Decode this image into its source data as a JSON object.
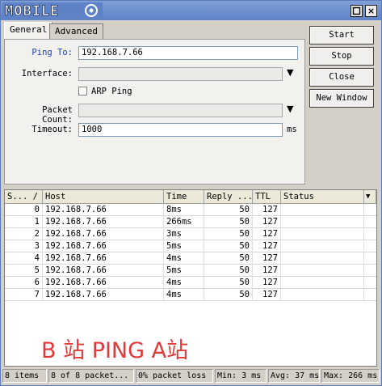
{
  "window": {
    "title": "MOBILE",
    "close_glyph": "×"
  },
  "tabs": [
    {
      "label": "General"
    },
    {
      "label": "Advanced"
    }
  ],
  "form": {
    "ping_to_label": "Ping To:",
    "ping_to_value": "192.168.7.66",
    "interface_label": "Interface:",
    "interface_value": "",
    "arp_ping_label": "ARP Ping",
    "arp_ping_checked": false,
    "packet_count_label": "Packet Count:",
    "packet_count_value": "",
    "timeout_label": "Timeout:",
    "timeout_value": "1000",
    "timeout_unit": "ms"
  },
  "buttons": {
    "start": "Start",
    "stop": "Stop",
    "close": "Close",
    "new_window": "New Window"
  },
  "table": {
    "headers": [
      "S... /",
      "Host",
      "Time",
      "Reply ...",
      "TTL",
      "Status"
    ],
    "rows": [
      {
        "seq": "0",
        "host": "192.168.7.66",
        "time": "8ms",
        "reply": "50",
        "ttl": "127",
        "status": ""
      },
      {
        "seq": "1",
        "host": "192.168.7.66",
        "time": "266ms",
        "reply": "50",
        "ttl": "127",
        "status": ""
      },
      {
        "seq": "2",
        "host": "192.168.7.66",
        "time": "3ms",
        "reply": "50",
        "ttl": "127",
        "status": ""
      },
      {
        "seq": "3",
        "host": "192.168.7.66",
        "time": "5ms",
        "reply": "50",
        "ttl": "127",
        "status": ""
      },
      {
        "seq": "4",
        "host": "192.168.7.66",
        "time": "4ms",
        "reply": "50",
        "ttl": "127",
        "status": ""
      },
      {
        "seq": "5",
        "host": "192.168.7.66",
        "time": "5ms",
        "reply": "50",
        "ttl": "127",
        "status": ""
      },
      {
        "seq": "6",
        "host": "192.168.7.66",
        "time": "4ms",
        "reply": "50",
        "ttl": "127",
        "status": ""
      },
      {
        "seq": "7",
        "host": "192.168.7.66",
        "time": "4ms",
        "reply": "50",
        "ttl": "127",
        "status": ""
      }
    ]
  },
  "annotation": "B 站 PING A站",
  "annotation_color": "#e03a3a",
  "statusbar": {
    "items": "8 items",
    "packets": "8 of 8 packet...",
    "loss": "0% packet loss",
    "min": "Min: 3 ms",
    "avg": "Avg: 37 ms",
    "max": "Max: 266 ms"
  },
  "colors": {
    "titlebar": "#5d82c8",
    "dialog_bg": "#d4d0c8",
    "field_border": "#7f9db9",
    "ping_label": "#1a3fb0"
  }
}
